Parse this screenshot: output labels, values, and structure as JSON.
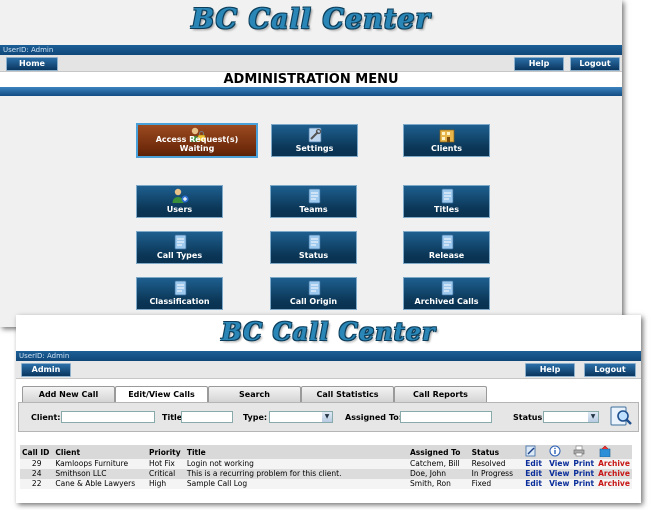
{
  "admin_window": {
    "logo": "BC Call Center",
    "userid": "UserID: Admin",
    "nav": {
      "home": "Home",
      "help": "Help",
      "logout": "Logout"
    },
    "title": "ADMINISTRATION MENU",
    "menu": [
      {
        "label": "Access Request(s) Waiting",
        "icon": "user-lock-icon"
      },
      {
        "label": "Settings",
        "icon": "tools-icon"
      },
      {
        "label": "Clients",
        "icon": "building-icon"
      },
      {
        "label": "Users",
        "icon": "add-user-icon"
      },
      {
        "label": "Teams",
        "icon": "notepad-icon"
      },
      {
        "label": "Titles",
        "icon": "notepad-icon"
      },
      {
        "label": "Call Types",
        "icon": "notepad-icon"
      },
      {
        "label": "Status",
        "icon": "notepad-icon"
      },
      {
        "label": "Release",
        "icon": "notepad-icon"
      },
      {
        "label": "Classification",
        "icon": "notepad-icon"
      },
      {
        "label": "Call Origin",
        "icon": "notepad-icon"
      },
      {
        "label": "Archived Calls",
        "icon": "archive-icon"
      }
    ]
  },
  "calls_window": {
    "logo": "BC Call Center",
    "userid": "UserID: Admin",
    "nav": {
      "admin": "Admin",
      "help": "Help",
      "logout": "Logout"
    },
    "tabs": [
      "Add New Call",
      "Edit/View Calls",
      "Search",
      "Call Statistics",
      "Call Reports"
    ],
    "search": {
      "client_label": "Client:",
      "title_label": "Title:",
      "type_label": "Type:",
      "assigned_label": "Assigned To:",
      "status_label": "Status:"
    },
    "columns": [
      "Call ID",
      "Client",
      "Priority",
      "Title",
      "Assigned To",
      "Status"
    ],
    "rows": [
      {
        "id": "29",
        "client": "Kamloops Furniture",
        "priority": "Hot Fix",
        "title": "Login not working",
        "assigned": "Catchem, Bill",
        "status": "Resolved"
      },
      {
        "id": "24",
        "client": "Smithson LLC",
        "priority": "Critical",
        "title": "This is a recurring problem for this client.",
        "assigned": "Doe, John",
        "status": "In Progress"
      },
      {
        "id": "22",
        "client": "Cane & Able Lawyers",
        "priority": "High",
        "title": "Sample Call Log",
        "assigned": "Smith, Ron",
        "status": "Fixed"
      }
    ],
    "actions": {
      "edit": "Edit",
      "view": "View",
      "print": "Print",
      "archive": "Archive"
    }
  }
}
